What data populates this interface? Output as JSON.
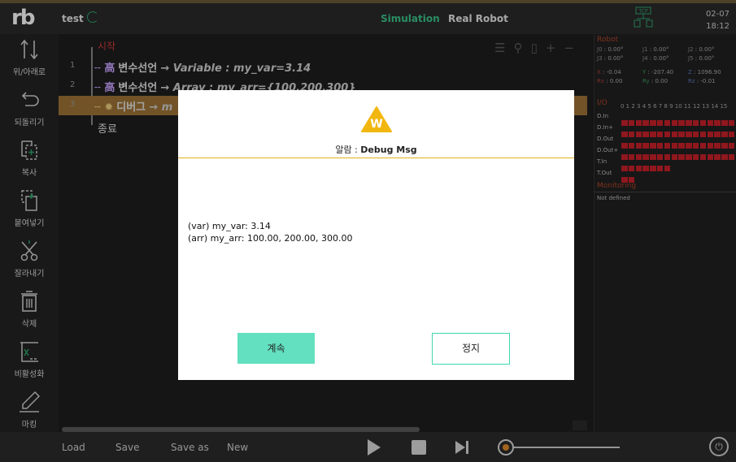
{
  "header": {
    "project_name": "test",
    "tab_simulation": "Simulation",
    "tab_real_robot": "Real Robot",
    "tcp_label": "TCP",
    "date": "02-07",
    "time": "18:12",
    "accent_color": "#3bc48a"
  },
  "toolbar": {
    "items": [
      {
        "label": "위/아래로",
        "icon": "move-up-down-icon"
      },
      {
        "label": "되돌리기",
        "icon": "undo-icon"
      },
      {
        "label": "복사",
        "icon": "copy-icon"
      },
      {
        "label": "붙여넣기",
        "icon": "paste-icon"
      },
      {
        "label": "잘라내기",
        "icon": "cut-icon"
      },
      {
        "label": "삭제",
        "icon": "delete-icon"
      },
      {
        "label": "비활성화",
        "icon": "disable-icon"
      },
      {
        "label": "마킹",
        "icon": "marking-icon"
      }
    ]
  },
  "editor": {
    "start_label": "시작",
    "end_label": "종료",
    "lines": [
      {
        "num": "1",
        "keyword": "변수선언",
        "arg": "Variable : my_var=3.14"
      },
      {
        "num": "2",
        "keyword": "변수선언",
        "arg": "Array : my_arr={100,200,300}"
      },
      {
        "num": "3",
        "keyword": "디버그",
        "arg": "m"
      }
    ]
  },
  "robot_panel": {
    "title": "Robot",
    "joints": [
      {
        "k": "J0",
        "v": "0.00°"
      },
      {
        "k": "J1",
        "v": "0.00°"
      },
      {
        "k": "J2",
        "v": "0.00°"
      },
      {
        "k": "J3",
        "v": "0.00°"
      },
      {
        "k": "J4",
        "v": "0.00°"
      },
      {
        "k": "J5",
        "v": "0.00°"
      }
    ],
    "pose": [
      {
        "k": "X",
        "v": "-0.04"
      },
      {
        "k": "Y",
        "v": "-207.40"
      },
      {
        "k": "Z",
        "v": "1096.90"
      },
      {
        "k": "Rx",
        "v": "0.00"
      },
      {
        "k": "Ry",
        "v": "0.00"
      },
      {
        "k": "Rz",
        "v": "-0.01"
      }
    ],
    "io_title": "I/O",
    "io_header": "0 1 2 3 4 5 6 7 8 9 10 11 12 13 14 15",
    "io_rows": [
      {
        "name": "D.In",
        "count": 16
      },
      {
        "name": "D.In+",
        "count": 16
      },
      {
        "name": "D.Out",
        "count": 16
      },
      {
        "name": "D.Out+",
        "count": 16
      },
      {
        "name": "T.In",
        "count": 7
      },
      {
        "name": "T.Out",
        "count": 2
      }
    ],
    "monitoring_title": "Monitoring",
    "monitoring_text": "Not defined",
    "led_color": "#c8202a"
  },
  "bottom": {
    "load": "Load",
    "save": "Save",
    "save_as": "Save as",
    "new": "New"
  },
  "dialog": {
    "icon_letter": "W",
    "title_prefix": "알람 : ",
    "title_bold": "Debug Msg",
    "message_line1": "(var) my_var: 3.14",
    "message_line2": "(arr) my_arr: 100.00, 200.00, 300.00",
    "continue_label": "계속",
    "stop_label": "정지"
  }
}
